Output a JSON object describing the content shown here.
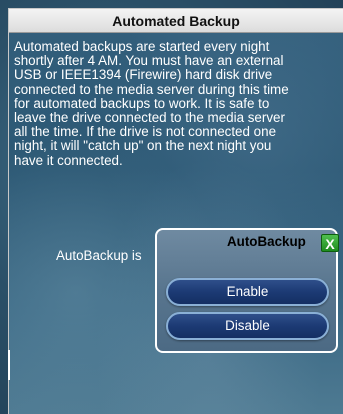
{
  "window": {
    "title": "Automated Backup"
  },
  "main": {
    "description": "Automated backups are started every night\nshortly after 4 AM. You must have an external\nUSB or IEEE1394 (Firewire) hard disk drive\nconnected to the media server during this time\nfor automated backups to work. It is safe to\nleave the drive connected to the media server\nall the time. If the drive is not connected one\nnight, it will \"catch up\" on the next night you\nhave it connected.",
    "status_label": "AutoBackup is"
  },
  "popup": {
    "title": "AutoBackup",
    "close_label": "X",
    "enable_label": "Enable",
    "disable_label": "Disable"
  },
  "colors": {
    "close_button": "#1e8c1e",
    "popup_button": "#1c3a74",
    "popup_button_border": "#8ab0d6"
  }
}
